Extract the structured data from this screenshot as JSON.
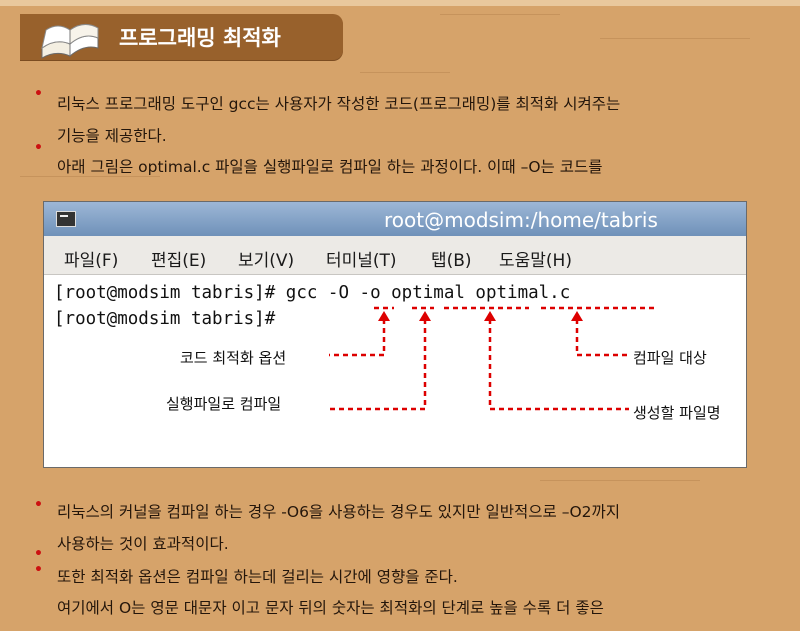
{
  "title": {
    "text": "프로그래밍 최적화",
    "icon": "open-book-icon"
  },
  "paragraphs": {
    "p1_line1": "리눅스 프로그래밍 도구인 gcc는 사용자가 작성한 코드(프로그래밍)를 최적화 시켜주는",
    "p1_line2": "기능을 제공한다.",
    "p2_line1": "아래 그림은 optimal.c 파일을 실행파일로 컴파일 하는 과정이다. 이때 –O는 코드를",
    "p3_line1": "리눅스의 커널을 컴파일 하는 경우 -O6을 사용하는 경우도 있지만 일반적으로 –O2까지",
    "p3_line2": "사용하는 것이 효과적이다.",
    "p4_line1": "또한 최적화 옵션은 컴파일 하는데 걸리는 시간에 영향을 준다.",
    "p4_line2": "여기에서 O는 영문 대문자 이고 문자 뒤의 숫자는 최적화의 단계로 높을 수록 더 좋은"
  },
  "terminal": {
    "title": "root@modsim:/home/tabris",
    "menu": [
      "파일(F)",
      "편집(E)",
      "보기(V)",
      "터미널(T)",
      "탭(B)",
      "도움말(H)"
    ],
    "line1": "[root@modsim tabris]# gcc -O -o optimal optimal.c",
    "line2": "[root@modsim tabris]#"
  },
  "annotations": {
    "opt_code": "코드 최적화 옵션",
    "compile_exec": "실행파일로 컴파일",
    "compile_target": "컴파일 대상",
    "output_name": "생성할 파일명"
  },
  "colors": {
    "background": "#d6a36a",
    "title_bar": "#98612c",
    "bullet": "#cc1111",
    "arrow": "#dd0000"
  }
}
